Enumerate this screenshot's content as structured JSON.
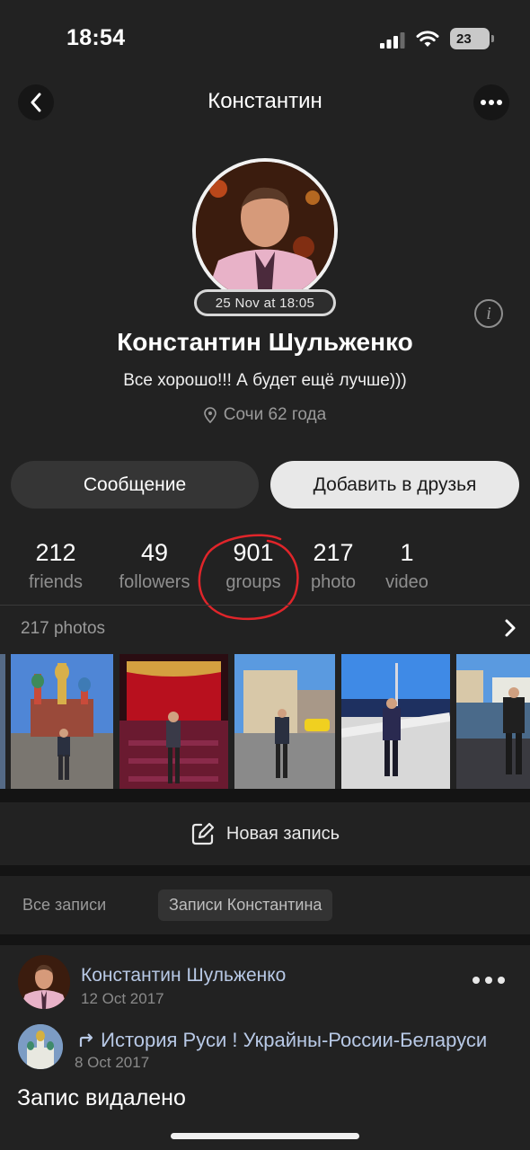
{
  "status_bar": {
    "time": "18:54",
    "battery": "23"
  },
  "header": {
    "title": "Константин"
  },
  "profile": {
    "last_seen": "25 Nov at 18:05",
    "name": "Константин Шульженко",
    "status": "Все хорошо!!! А будет ещё лучше)))",
    "location": "Сочи 62 года"
  },
  "actions": {
    "message": "Сообщение",
    "add_friend": "Добавить в друзья"
  },
  "counters": [
    {
      "value": "212",
      "label": "friends"
    },
    {
      "value": "49",
      "label": "followers"
    },
    {
      "value": "901",
      "label": "groups"
    },
    {
      "value": "217",
      "label": "photo"
    },
    {
      "value": "1",
      "label": "video"
    }
  ],
  "photos": {
    "title": "217 photos"
  },
  "new_post": {
    "label": "Новая запись"
  },
  "filters": {
    "all": "Все записи",
    "own": "Записи Константина"
  },
  "post": {
    "author": "Константин Шульженко",
    "date": "12 Oct 2017",
    "repost_title": "История Руси ! Украйны-России-Беларуси",
    "repost_date": "8 Oct 2017",
    "text": "Запис видалено"
  },
  "colors": {
    "background": "#222222",
    "link": "#b8c9e6",
    "muted": "#8f8f8f",
    "annotation": "#e0252a"
  }
}
